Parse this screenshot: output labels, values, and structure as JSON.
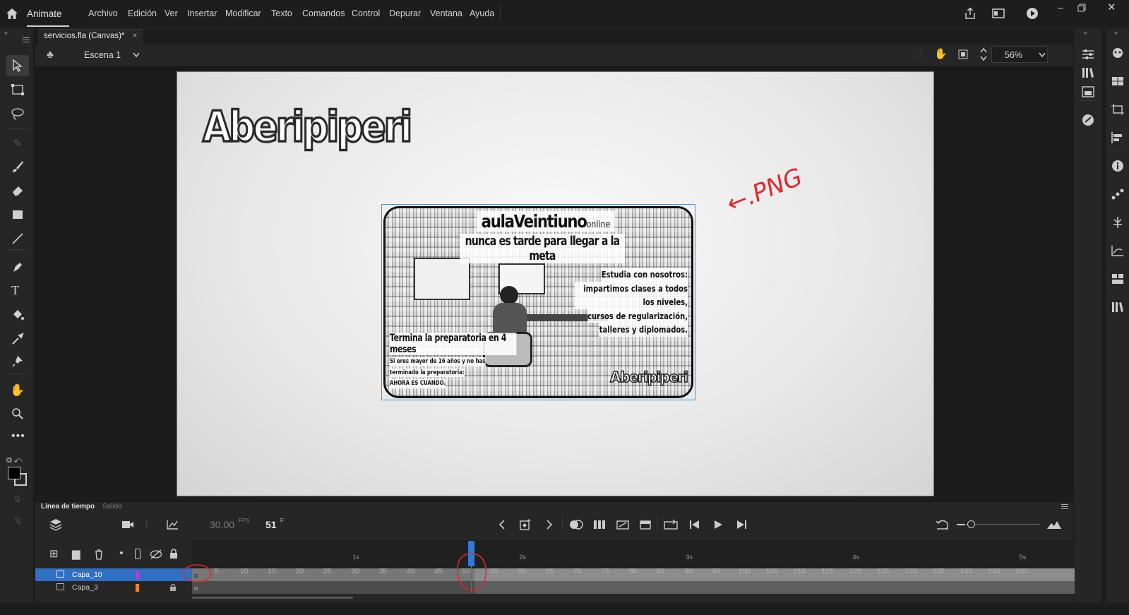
{
  "app": {
    "name": "Animate"
  },
  "menu": [
    "Archivo",
    "Edición",
    "Ver",
    "Insertar",
    "Modificar",
    "Texto",
    "Comandos",
    "Control",
    "Depurar",
    "Ventana",
    "Ayuda"
  ],
  "document": {
    "tab": "servicios.fla (Canvas)*",
    "close": "×"
  },
  "scene": {
    "name": "Escena 1",
    "zoom": "56%"
  },
  "stage": {
    "logo": "Aberipiperi",
    "annotation": "←.PNG",
    "ad": {
      "brand": "aulaVeintiuno",
      "brand_suffix": "online",
      "tagline": "nunca es tarde para llegar a la meta",
      "right_lines": [
        "Estudia con nosotros:",
        "impartimos clases a todos los niveles,",
        "cursos de regularización,",
        "talleres y diplomados."
      ],
      "left_title": "Termina la preparatoria en 4 meses",
      "left_lines": [
        "Si eres mayor de 16 años y no has",
        "terminado la preparatoria:",
        "AHORA ES CUANDO."
      ],
      "brand_logo": "Aberipiperi"
    }
  },
  "timeline": {
    "tabs": [
      "Línea de tiempo",
      "Salida"
    ],
    "fps": "30.00",
    "fps_unit": "FPS",
    "frame": "51",
    "frame_unit": "F",
    "seconds": [
      "1s",
      "2s",
      "3s",
      "4s",
      "5s"
    ],
    "ruler": [
      "5",
      "10",
      "15",
      "20",
      "25",
      "30",
      "35",
      "40",
      "45",
      "50",
      "55",
      "60",
      "65",
      "70",
      "75",
      "80",
      "85",
      "90",
      "95",
      "100",
      "105",
      "110",
      "115",
      "120",
      "125",
      "130",
      "135",
      "140",
      "145",
      "150"
    ],
    "layers": [
      {
        "name": "Capa_10",
        "color": "#b63fe0"
      },
      {
        "name": "Capa_3",
        "color": "#f08a1c"
      }
    ],
    "playhead_frame": 51
  },
  "colors": {
    "accent": "#2f7bd8",
    "annotation": "#e0282c"
  }
}
